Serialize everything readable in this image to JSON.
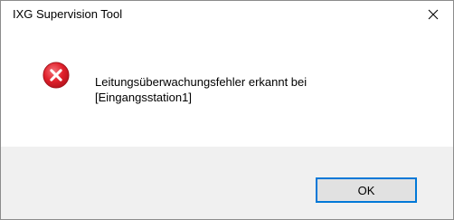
{
  "dialog": {
    "title": "IXG Supervision Tool",
    "message_line1": "Leitungsüberwachungsfehler erkannt bei",
    "message_line2": "[Eingangsstation1]",
    "ok_label": "OK",
    "icon": "error-icon",
    "close_icon": "close-icon"
  },
  "colors": {
    "error_red": "#e0202b",
    "button_focus_border": "#0078d7",
    "footer_bg": "#f0f0f0"
  }
}
